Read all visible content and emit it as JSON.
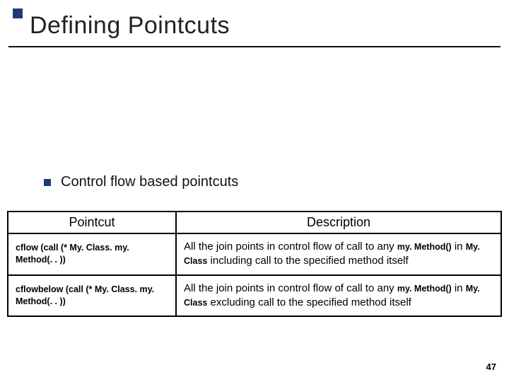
{
  "title": "Defining Pointcuts",
  "bullet": "Control flow based pointcuts",
  "table": {
    "headers": {
      "col1": "Pointcut",
      "col2": "Description"
    },
    "rows": [
      {
        "pointcut": "cflow (call (* My. Class. my. Method(. . ))",
        "desc_pre": "All the join points in control flow of call to any ",
        "desc_code1": "my. Method()",
        "desc_mid": " in ",
        "desc_code2": "My. Class",
        "desc_post": " including call to the specified method itself"
      },
      {
        "pointcut": "cflowbelow (call (* My. Class. my. Method(. . ))",
        "desc_pre": "All the join points in control flow of call to any ",
        "desc_code1": "my. Method()",
        "desc_mid": " in ",
        "desc_code2": "My. Class",
        "desc_post": " excluding call to the specified method itself"
      }
    ]
  },
  "page_number": "47"
}
